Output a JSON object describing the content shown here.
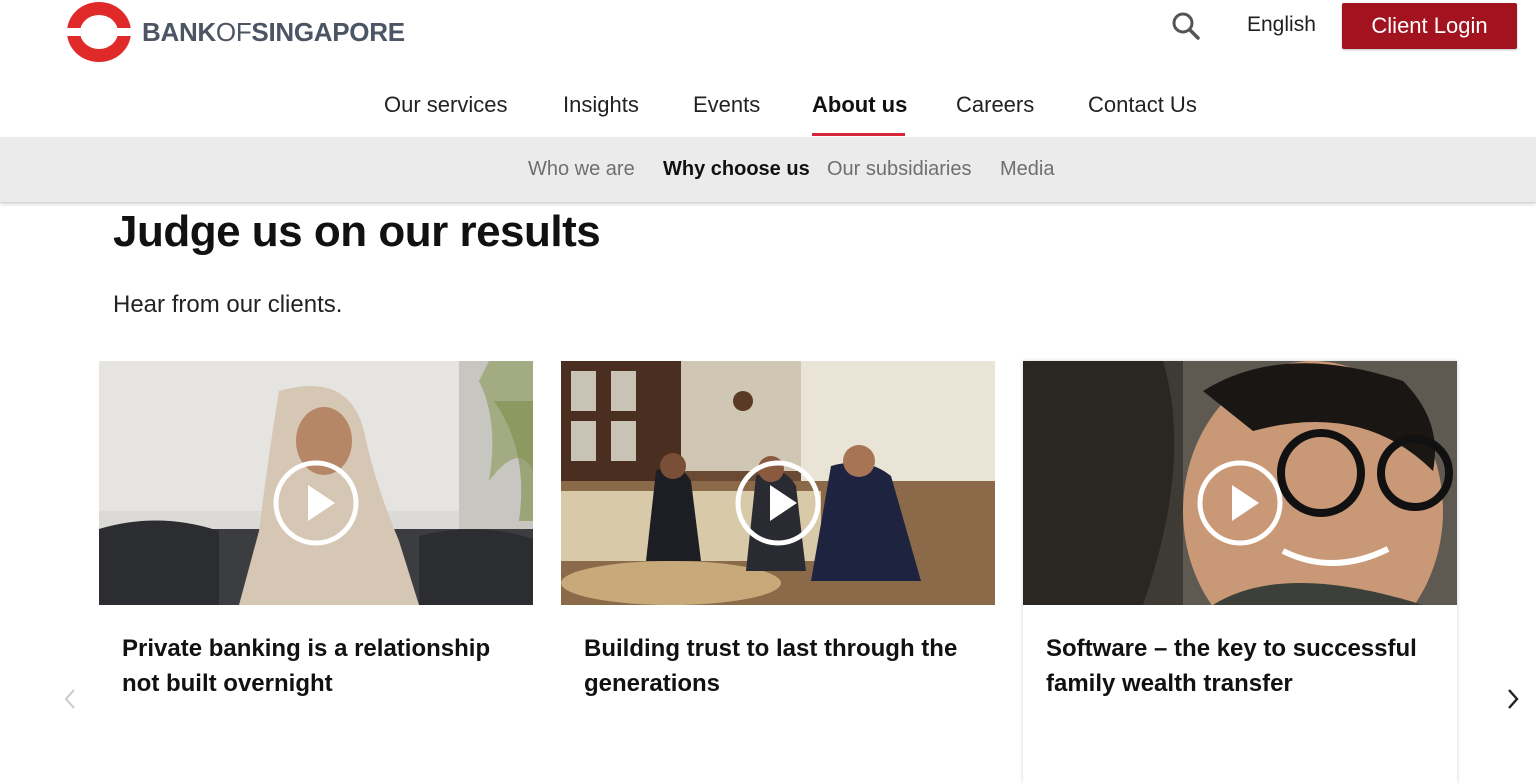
{
  "brand": {
    "part1": "BANK",
    "part2": "OF",
    "part3": "SINGAPORE",
    "accent_color": "#a3131f",
    "logo_red": "#e02a2a"
  },
  "header": {
    "search_icon": "search-icon",
    "language": "English",
    "login_label": "Client Login"
  },
  "main_nav": {
    "items": [
      {
        "label": "Our services"
      },
      {
        "label": "Insights"
      },
      {
        "label": "Events"
      },
      {
        "label": "About us",
        "active": true
      },
      {
        "label": "Careers"
      },
      {
        "label": "Contact Us"
      }
    ]
  },
  "sub_nav": {
    "items": [
      {
        "label": "Who we are"
      },
      {
        "label": "Why choose us",
        "active": true
      },
      {
        "label": "Our subsidiaries"
      },
      {
        "label": "Media"
      }
    ]
  },
  "section": {
    "title": "Judge us on our results",
    "subtitle": "Hear from our clients."
  },
  "cards": [
    {
      "title": "Private banking is a relationship not built overnight",
      "icon": "play-icon"
    },
    {
      "title": "Building trust to last through the generations",
      "icon": "play-icon"
    },
    {
      "title": "Software – the key to successful family wealth transfer",
      "icon": "play-icon"
    }
  ],
  "carousel": {
    "prev_icon": "chevron-left-icon",
    "next_icon": "chevron-right-icon"
  }
}
